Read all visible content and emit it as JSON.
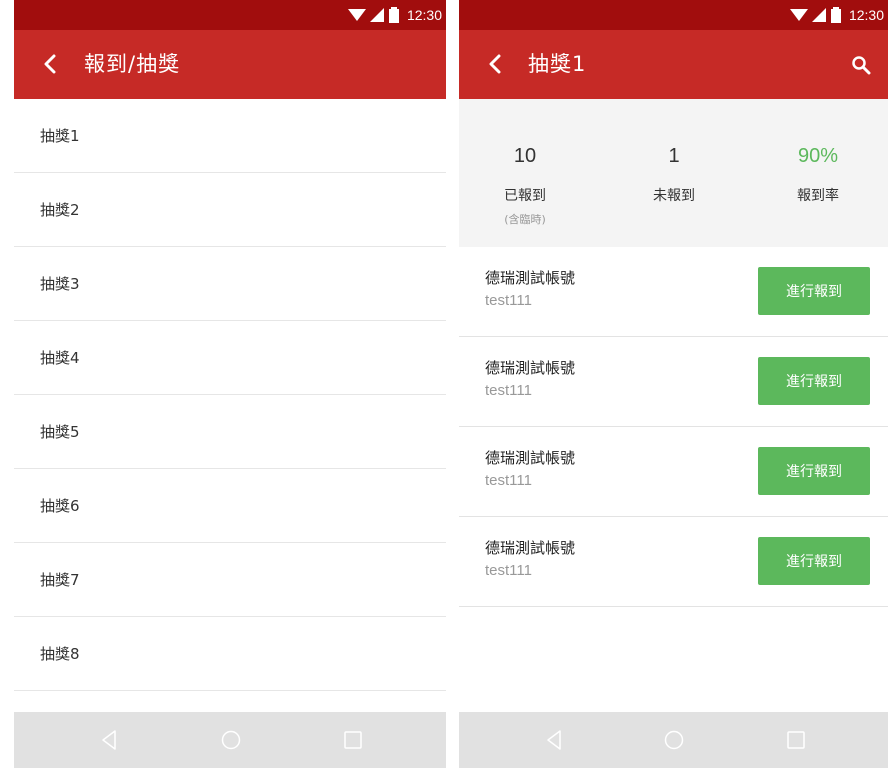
{
  "status_bar": {
    "time": "12:30"
  },
  "left_screen": {
    "title": "報到/抽獎",
    "items": [
      "抽獎1",
      "抽獎2",
      "抽獎3",
      "抽獎4",
      "抽獎5",
      "抽獎6",
      "抽獎7",
      "抽獎8"
    ]
  },
  "right_screen": {
    "title": "抽獎1",
    "stats": {
      "checked_in": {
        "value": "10",
        "label": "已報到",
        "note": "(含臨時)"
      },
      "not_checked_in": {
        "value": "1",
        "label": "未報到"
      },
      "rate": {
        "value": "90%",
        "label": "報到率"
      }
    },
    "entries": [
      {
        "name": "德瑞測試帳號",
        "account": "test111",
        "button": "進行報到"
      },
      {
        "name": "德瑞測試帳號",
        "account": "test111",
        "button": "進行報到"
      },
      {
        "name": "德瑞測試帳號",
        "account": "test111",
        "button": "進行報到"
      },
      {
        "name": "德瑞測試帳號",
        "account": "test111",
        "button": "進行報到"
      }
    ]
  },
  "icons": {
    "back": "back-chevron-icon",
    "search": "search-icon",
    "wifi": "wifi-icon",
    "signal": "signal-icon",
    "battery": "battery-icon",
    "nav_back": "nav-back-icon",
    "nav_home": "nav-home-icon",
    "nav_recent": "nav-recent-icon"
  },
  "colors": {
    "status_bar": "#a10d0d",
    "app_bar": "#c62a26",
    "accent_green": "#5cb85c",
    "nav_bar": "#e1e1e1"
  }
}
